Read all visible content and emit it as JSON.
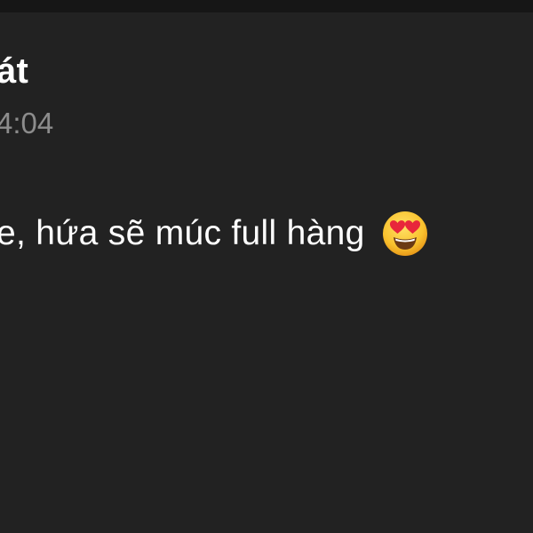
{
  "post": {
    "author": "át",
    "time": "4:04",
    "message": "e, hứa sẽ múc full hàng",
    "emoji": "smiling-face-with-heart-eyes"
  },
  "colors": {
    "background": "#222222",
    "top_bar": "#161616",
    "text": "#ffffff",
    "time": "#8c8c8c"
  }
}
